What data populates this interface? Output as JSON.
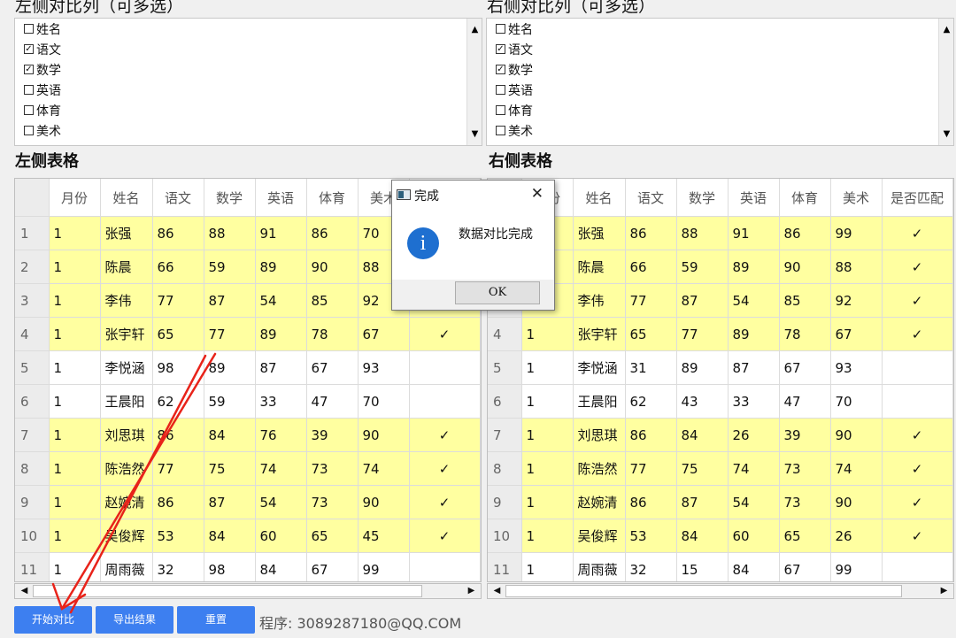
{
  "left_panel": {
    "title": "左侧对比列（可多选）",
    "options": [
      {
        "label": "姓名",
        "checked": false
      },
      {
        "label": "语文",
        "checked": true
      },
      {
        "label": "数学",
        "checked": true
      },
      {
        "label": "英语",
        "checked": false
      },
      {
        "label": "体育",
        "checked": false
      },
      {
        "label": "美术",
        "checked": false
      }
    ]
  },
  "right_panel": {
    "title": "右侧对比列（可多选）",
    "options": [
      {
        "label": "姓名",
        "checked": false
      },
      {
        "label": "语文",
        "checked": true
      },
      {
        "label": "数学",
        "checked": true
      },
      {
        "label": "英语",
        "checked": false
      },
      {
        "label": "体育",
        "checked": false
      },
      {
        "label": "美术",
        "checked": false
      }
    ]
  },
  "left_table": {
    "title": "左侧表格",
    "columns": [
      "月份",
      "姓名",
      "语文",
      "数学",
      "英语",
      "体育",
      "美术",
      ""
    ],
    "rows": [
      {
        "n": "1",
        "cells": [
          "1",
          "张强",
          "86",
          "88",
          "91",
          "86",
          "70",
          ""
        ],
        "hl": true
      },
      {
        "n": "2",
        "cells": [
          "1",
          "陈晨",
          "66",
          "59",
          "89",
          "90",
          "88",
          ""
        ],
        "hl": true
      },
      {
        "n": "3",
        "cells": [
          "1",
          "李伟",
          "77",
          "87",
          "54",
          "85",
          "92",
          ""
        ],
        "hl": true
      },
      {
        "n": "4",
        "cells": [
          "1",
          "张宇轩",
          "65",
          "77",
          "89",
          "78",
          "67",
          "✓"
        ],
        "hl": true
      },
      {
        "n": "5",
        "cells": [
          "1",
          "李悦涵",
          "98",
          "89",
          "87",
          "67",
          "93",
          ""
        ],
        "hl": false
      },
      {
        "n": "6",
        "cells": [
          "1",
          "王晨阳",
          "62",
          "59",
          "33",
          "47",
          "70",
          ""
        ],
        "hl": false
      },
      {
        "n": "7",
        "cells": [
          "1",
          "刘思琪",
          "86",
          "84",
          "76",
          "39",
          "90",
          "✓"
        ],
        "hl": true
      },
      {
        "n": "8",
        "cells": [
          "1",
          "陈浩然",
          "77",
          "75",
          "74",
          "73",
          "74",
          "✓"
        ],
        "hl": true
      },
      {
        "n": "9",
        "cells": [
          "1",
          "赵婉清",
          "86",
          "87",
          "54",
          "73",
          "90",
          "✓"
        ],
        "hl": true
      },
      {
        "n": "10",
        "cells": [
          "1",
          "吴俊辉",
          "53",
          "84",
          "60",
          "65",
          "45",
          "✓"
        ],
        "hl": true
      },
      {
        "n": "11",
        "cells": [
          "1",
          "周雨薇",
          "32",
          "98",
          "84",
          "67",
          "99",
          ""
        ],
        "hl": false
      }
    ]
  },
  "right_table": {
    "title": "右侧表格",
    "columns": [
      "月份",
      "姓名",
      "语文",
      "数学",
      "英语",
      "体育",
      "美术",
      "是否匹配"
    ],
    "rows": [
      {
        "n": "1",
        "cells": [
          "1",
          "张强",
          "86",
          "88",
          "91",
          "86",
          "99",
          "✓"
        ],
        "hl": true
      },
      {
        "n": "2",
        "cells": [
          "1",
          "陈晨",
          "66",
          "59",
          "89",
          "90",
          "88",
          "✓"
        ],
        "hl": true
      },
      {
        "n": "3",
        "cells": [
          "1",
          "李伟",
          "77",
          "87",
          "54",
          "85",
          "92",
          "✓"
        ],
        "hl": true
      },
      {
        "n": "4",
        "cells": [
          "1",
          "张宇轩",
          "65",
          "77",
          "89",
          "78",
          "67",
          "✓"
        ],
        "hl": true
      },
      {
        "n": "5",
        "cells": [
          "1",
          "李悦涵",
          "31",
          "89",
          "87",
          "67",
          "93",
          ""
        ],
        "hl": false
      },
      {
        "n": "6",
        "cells": [
          "1",
          "王晨阳",
          "62",
          "43",
          "33",
          "47",
          "70",
          ""
        ],
        "hl": false
      },
      {
        "n": "7",
        "cells": [
          "1",
          "刘思琪",
          "86",
          "84",
          "26",
          "39",
          "90",
          "✓"
        ],
        "hl": true
      },
      {
        "n": "8",
        "cells": [
          "1",
          "陈浩然",
          "77",
          "75",
          "74",
          "73",
          "74",
          "✓"
        ],
        "hl": true
      },
      {
        "n": "9",
        "cells": [
          "1",
          "赵婉清",
          "86",
          "87",
          "54",
          "73",
          "90",
          "✓"
        ],
        "hl": true
      },
      {
        "n": "10",
        "cells": [
          "1",
          "吴俊辉",
          "53",
          "84",
          "60",
          "65",
          "26",
          "✓"
        ],
        "hl": true
      },
      {
        "n": "11",
        "cells": [
          "1",
          "周雨薇",
          "32",
          "15",
          "84",
          "67",
          "99",
          ""
        ],
        "hl": false
      }
    ]
  },
  "dialog": {
    "title": "完成",
    "message": "数据对比完成",
    "ok_label": "OK",
    "close_glyph": "✕",
    "info_glyph": "i"
  },
  "buttons": {
    "start": "开始对比",
    "export": "导出结果",
    "reset": "重置"
  },
  "footer": {
    "credit": "程序: 3089287180@QQ.COM"
  },
  "colors": {
    "highlight": "#ffffa0",
    "button": "#3d7ff0",
    "annotation_arrow": "#e8231a",
    "info_icon": "#1e6fd0"
  },
  "icons": {
    "scroll_up": "▲",
    "scroll_down": "▼",
    "scroll_left": "◀",
    "scroll_right": "▶"
  }
}
